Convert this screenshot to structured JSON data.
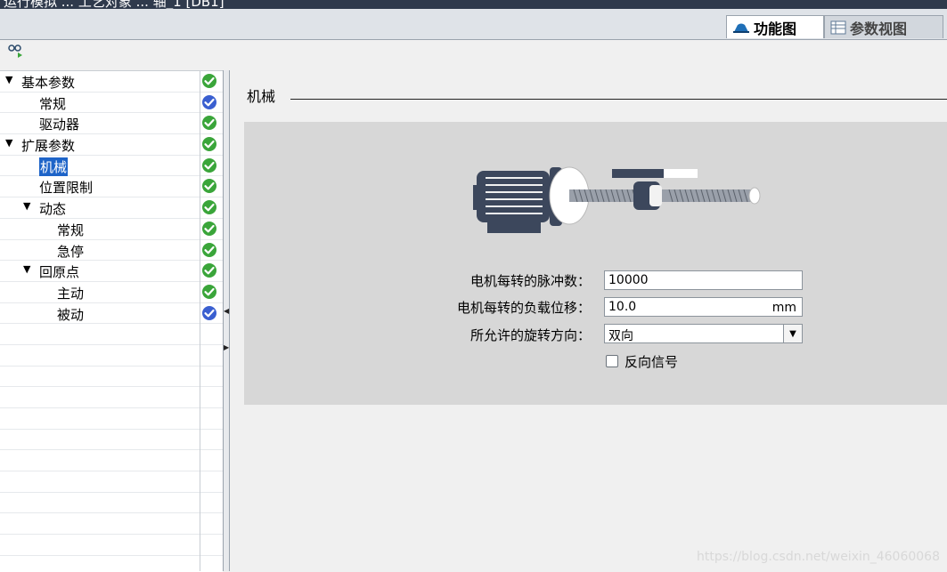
{
  "window": {
    "title_partial": "运行模拟 ... 工艺对象 ... 轴_1 [DB1]"
  },
  "view_tabs": [
    {
      "label": "功能图",
      "icon": "function-diagram-icon",
      "active": true
    },
    {
      "label": "参数视图",
      "icon": "parameter-view-icon",
      "active": false
    }
  ],
  "toolbar": {
    "icon": "toggle-view-icon"
  },
  "nav_tree": {
    "items": [
      {
        "label": "基本参数",
        "level": 0,
        "expandable": true,
        "status": "ok"
      },
      {
        "label": "常规",
        "level": 1,
        "expandable": false,
        "status": "info"
      },
      {
        "label": "驱动器",
        "level": 1,
        "expandable": false,
        "status": "ok"
      },
      {
        "label": "扩展参数",
        "level": 0,
        "expandable": true,
        "status": "ok"
      },
      {
        "label": "机械",
        "level": 1,
        "expandable": false,
        "status": "ok",
        "selected": true
      },
      {
        "label": "位置限制",
        "level": 1,
        "expandable": false,
        "status": "ok"
      },
      {
        "label": "动态",
        "level": 1,
        "expandable": true,
        "status": "ok"
      },
      {
        "label": "常规",
        "level": 2,
        "expandable": false,
        "status": "ok"
      },
      {
        "label": "急停",
        "level": 2,
        "expandable": false,
        "status": "ok"
      },
      {
        "label": "回原点",
        "level": 1,
        "expandable": true,
        "status": "ok"
      },
      {
        "label": "主动",
        "level": 2,
        "expandable": false,
        "status": "ok"
      },
      {
        "label": "被动",
        "level": 2,
        "expandable": false,
        "status": "info"
      }
    ]
  },
  "section": {
    "title": "机械"
  },
  "form": {
    "pulses_per_rev": {
      "label": "电机每转的脉冲数：",
      "value": "10000"
    },
    "load_per_rev": {
      "label": "电机每转的负载位移：",
      "value": "10.0",
      "unit": "mm"
    },
    "rotation_dir": {
      "label": "所允许的旋转方向：",
      "value": "双向"
    },
    "invert_signal": {
      "label": "反向信号",
      "checked": false
    }
  },
  "watermark": "https://blog.csdn.net/weixin_46060068",
  "colors": {
    "status_ok": "#3aa53a",
    "status_info": "#3a5fd0",
    "selection": "#1e64c8"
  }
}
